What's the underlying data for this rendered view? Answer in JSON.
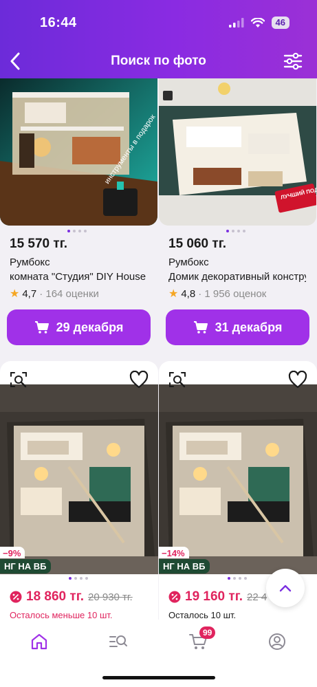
{
  "status_bar": {
    "time": "16:44",
    "battery": "46"
  },
  "header": {
    "title": "Поиск по фото"
  },
  "products_top": [
    {
      "price": "15 570 тг.",
      "brand": "Румбокс",
      "name": "комната \"Студия\" DIY House",
      "rating": "4,7",
      "reviews": "· 164 оценки",
      "delivery": "29 декабря",
      "image_text": "инструменты в подарок"
    },
    {
      "price": "15 060 тг.",
      "brand": "Румбокс",
      "name": "Домик декоративный конструктор",
      "rating": "4,8",
      "reviews": "· 1 956 оценок",
      "delivery": "31 декабря",
      "image_text": "ЛУЧШИЙ ПОДАРОК!"
    }
  ],
  "products_bottom": [
    {
      "discount": "−9%",
      "badge": "НГ НА ВБ",
      "price": "18 860 тг.",
      "old_price": "20 930 тг.",
      "stock": "Осталось меньше 10 шт.",
      "stock_level": 0.05
    },
    {
      "discount": "−14%",
      "badge": "НГ НА ВБ",
      "price": "19 160 тг.",
      "old_price": "22 4",
      "stock": "Осталось 10 шт.",
      "stock_level": 0.05
    }
  ],
  "tabbar": {
    "cart_count": "99"
  },
  "colors": {
    "brand": "#8a2be2",
    "button": "#a031e8",
    "sale": "#e0245e",
    "badge_green": "#1f4a33"
  }
}
